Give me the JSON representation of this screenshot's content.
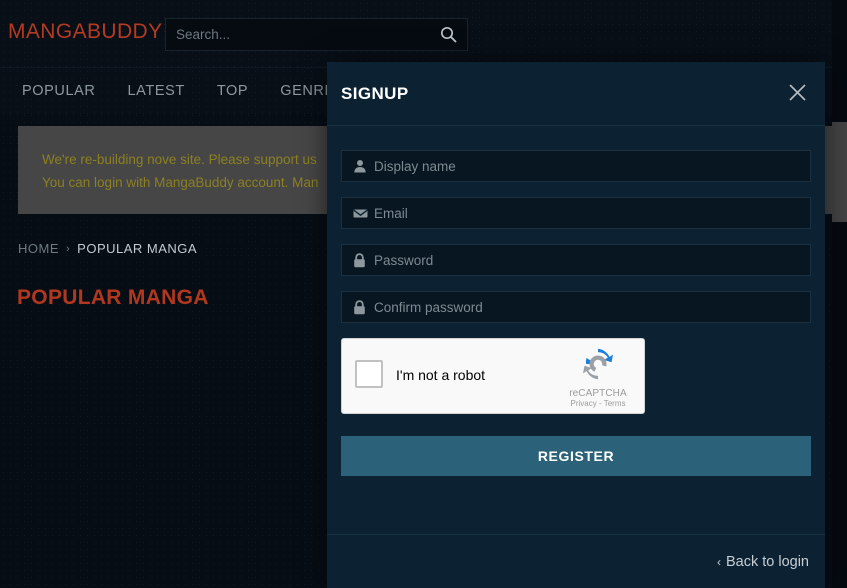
{
  "site": {
    "logo": "MANGABUDDY",
    "logo_color": "#b33b21"
  },
  "search": {
    "placeholder": "Search...",
    "value": "",
    "icon": "search-icon"
  },
  "nav": {
    "items": [
      {
        "label": "POPULAR"
      },
      {
        "label": "LATEST"
      },
      {
        "label": "TOP"
      },
      {
        "label": "GENRES"
      }
    ]
  },
  "alert": {
    "line1": "We're re-building nove site. Please support us",
    "line2": "You can login with MangaBuddy account. Man",
    "text_color": "#8c8021",
    "bg_color": "#464646"
  },
  "breadcrumb": {
    "home": "HOME",
    "separator": "›",
    "current": "POPULAR MANGA"
  },
  "page": {
    "title": "POPULAR MANGA",
    "title_color": "#b1381f"
  },
  "modal": {
    "title": "SIGNUP",
    "close_icon": "close-icon",
    "fields": [
      {
        "icon": "user-icon",
        "placeholder": "Display name",
        "value": ""
      },
      {
        "icon": "envelope-icon",
        "placeholder": "Email",
        "value": ""
      },
      {
        "icon": "lock-icon",
        "placeholder": "Password",
        "value": ""
      },
      {
        "icon": "lock-icon",
        "placeholder": "Confirm password",
        "value": ""
      }
    ],
    "recaptcha": {
      "label": "I'm not a robot",
      "brand": "reCAPTCHA",
      "legal": "Privacy - Terms",
      "checked": false,
      "logo_color": "#1c7ed6"
    },
    "register_label": "REGISTER",
    "register_color": "#2b6279",
    "footer": {
      "chevron": "‹",
      "back_label": "Back to login"
    }
  },
  "scrollbar": {
    "thumb_color": "#444444"
  }
}
